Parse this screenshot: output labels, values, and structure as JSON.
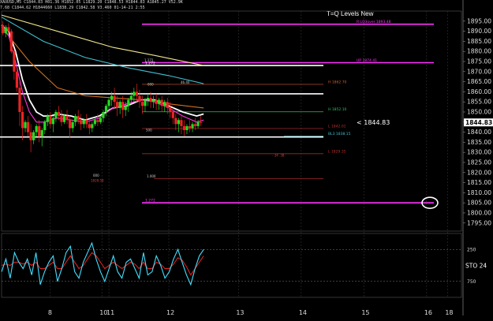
{
  "header": {
    "line1": "XAUUSD,M5  C1844.83  H01.36  H1852.05  L1829.20  C1848.53  H1844.83  A1845.27  V52.9K",
    "line2": "7.68  C1844.62  H1844660  L1838.29  C1842.58  V3.460  01-14-21  2:55"
  },
  "colors": {
    "background": "#000000",
    "candle_up": "#22dd22",
    "candle_down": "#ee2222",
    "level_line": "#ff33ff",
    "white_level": "#ffffff",
    "ma_white": "#ffffff",
    "ma_magenta": "#ff33dd",
    "ma_orange": "#d07020",
    "ma_yellow": "#f0e68c",
    "ma_cyan": "#40c0d0",
    "stoch_cyan": "#40e0ff",
    "stoch_red": "#e02020",
    "circle_marker": "#ffffff"
  },
  "chart_data": {
    "type": "line",
    "title": "T=Q Levels New",
    "current_price_label": "< 1844.83",
    "current_price_box": "1844.83",
    "ylim": [
      1791,
      1900
    ],
    "y_ticks": [
      1895.0,
      1890.0,
      1885.0,
      1880.0,
      1875.0,
      1870.0,
      1865.0,
      1860.0,
      1855.0,
      1850.0,
      1845.0,
      1840.0,
      1835.0,
      1830.0,
      1825.0,
      1820.0,
      1815.0,
      1810.0,
      1805.0,
      1800.0,
      1795.0
    ],
    "x_ticks": [
      "8",
      "10",
      "11",
      "12",
      "13",
      "14",
      "15",
      "16",
      "18"
    ],
    "x_tick_positions": [
      0.5,
      4.2,
      4.7,
      9,
      14,
      18.5,
      23,
      27.5,
      29
    ],
    "xlim": [
      -3,
      30
    ],
    "levels": [
      {
        "price": 1893.48,
        "color": "magenta",
        "label": "R:LQ3over 1893.48"
      },
      {
        "price": 1874.41,
        "color": "magenta",
        "label": "UP 1874.41"
      },
      {
        "price": 1873.0,
        "color": "white",
        "label": "1.272"
      },
      {
        "price": 1859.0,
        "color": "white",
        "label": ""
      },
      {
        "price": 1863.7,
        "color": "orange",
        "label": "H 1862.70"
      },
      {
        "price": 1850.1,
        "color": "green",
        "label": "H 1852.10"
      },
      {
        "price": 1841.81,
        "color": "red",
        "label": "L 1842.01"
      },
      {
        "price": 1837.6,
        "color": "white",
        "label": ""
      },
      {
        "price": 1838.15,
        "color": "cyan",
        "label": "BL3 1838.15"
      },
      {
        "price": 1829.35,
        "color": "red",
        "label": "L 1829.35"
      },
      {
        "price": 1817.0,
        "color": "red",
        "label": ""
      },
      {
        "price": 1805.0,
        "color": "magenta",
        "label": "1.272"
      }
    ],
    "annotations": [
      {
        "text": "1.272",
        "price": 1875.0
      },
      {
        "text": "000",
        "price": 1863.0
      },
      {
        "text": "46.40",
        "price": 1864.0
      },
      {
        "text": "500",
        "price": 1840.5
      },
      {
        "text": "1.000",
        "price": 1817.5
      },
      {
        "text": "000",
        "price": 1818.0
      },
      {
        "text": "1828.58",
        "price": 1815.5
      },
      {
        "text": "- 34 .38",
        "price": 1828.0
      }
    ],
    "candles": [
      {
        "x": -2.9,
        "o": 1893,
        "h": 1895,
        "c": 1889,
        "l": 1888
      },
      {
        "x": -2.7,
        "o": 1889,
        "h": 1893,
        "c": 1892,
        "l": 1887
      },
      {
        "x": -2.5,
        "o": 1892,
        "h": 1894,
        "c": 1890,
        "l": 1889
      },
      {
        "x": -2.3,
        "o": 1890,
        "h": 1891,
        "c": 1880,
        "l": 1879
      },
      {
        "x": -2.1,
        "o": 1880,
        "h": 1881,
        "c": 1870,
        "l": 1866
      },
      {
        "x": -1.9,
        "o": 1870,
        "h": 1872,
        "c": 1862,
        "l": 1860
      },
      {
        "x": -1.7,
        "o": 1862,
        "h": 1865,
        "c": 1850,
        "l": 1843
      },
      {
        "x": -1.5,
        "o": 1850,
        "h": 1853,
        "c": 1842,
        "l": 1836
      },
      {
        "x": -1.3,
        "o": 1842,
        "h": 1846,
        "c": 1845,
        "l": 1840
      },
      {
        "x": -1.1,
        "o": 1845,
        "h": 1848,
        "c": 1840,
        "l": 1838
      },
      {
        "x": -0.9,
        "o": 1840,
        "h": 1844,
        "c": 1836,
        "l": 1830
      },
      {
        "x": -0.7,
        "o": 1836,
        "h": 1841,
        "c": 1840,
        "l": 1834
      },
      {
        "x": -0.5,
        "o": 1840,
        "h": 1844,
        "c": 1843,
        "l": 1838
      },
      {
        "x": -0.3,
        "o": 1843,
        "h": 1846,
        "c": 1838,
        "l": 1835
      },
      {
        "x": -0.1,
        "o": 1838,
        "h": 1842,
        "c": 1841,
        "l": 1833
      },
      {
        "x": 0.1,
        "o": 1841,
        "h": 1846,
        "c": 1845,
        "l": 1839
      },
      {
        "x": 0.3,
        "o": 1845,
        "h": 1849,
        "c": 1848,
        "l": 1843
      },
      {
        "x": 0.5,
        "o": 1848,
        "h": 1850,
        "c": 1844,
        "l": 1842
      },
      {
        "x": 0.7,
        "o": 1844,
        "h": 1848,
        "c": 1847,
        "l": 1840
      },
      {
        "x": 0.9,
        "o": 1847,
        "h": 1851,
        "c": 1850,
        "l": 1845
      },
      {
        "x": 1.1,
        "o": 1850,
        "h": 1853,
        "c": 1848,
        "l": 1846
      },
      {
        "x": 1.3,
        "o": 1848,
        "h": 1851,
        "c": 1845,
        "l": 1843
      },
      {
        "x": 1.5,
        "o": 1845,
        "h": 1849,
        "c": 1848,
        "l": 1844
      },
      {
        "x": 1.7,
        "o": 1848,
        "h": 1851,
        "c": 1846,
        "l": 1844
      },
      {
        "x": 1.9,
        "o": 1846,
        "h": 1848,
        "c": 1842,
        "l": 1837
      },
      {
        "x": 2.1,
        "o": 1842,
        "h": 1846,
        "c": 1845,
        "l": 1840
      },
      {
        "x": 2.3,
        "o": 1845,
        "h": 1849,
        "c": 1848,
        "l": 1843
      },
      {
        "x": 2.5,
        "o": 1848,
        "h": 1851,
        "c": 1846,
        "l": 1844
      },
      {
        "x": 2.7,
        "o": 1846,
        "h": 1849,
        "c": 1844,
        "l": 1841
      },
      {
        "x": 2.9,
        "o": 1844,
        "h": 1847,
        "c": 1846,
        "l": 1842
      },
      {
        "x": 3.1,
        "o": 1846,
        "h": 1849,
        "c": 1844,
        "l": 1842
      },
      {
        "x": 3.3,
        "o": 1844,
        "h": 1846,
        "c": 1842,
        "l": 1839
      },
      {
        "x": 3.5,
        "o": 1842,
        "h": 1845,
        "c": 1844,
        "l": 1840
      },
      {
        "x": 3.7,
        "o": 1844,
        "h": 1847,
        "c": 1846,
        "l": 1843
      },
      {
        "x": 3.9,
        "o": 1846,
        "h": 1849,
        "c": 1845,
        "l": 1843
      },
      {
        "x": 4.1,
        "o": 1845,
        "h": 1848,
        "c": 1847,
        "l": 1844
      },
      {
        "x": 4.3,
        "o": 1847,
        "h": 1851,
        "c": 1850,
        "l": 1845
      },
      {
        "x": 4.5,
        "o": 1850,
        "h": 1854,
        "c": 1853,
        "l": 1848
      },
      {
        "x": 4.7,
        "o": 1853,
        "h": 1857,
        "c": 1856,
        "l": 1851
      },
      {
        "x": 4.9,
        "o": 1856,
        "h": 1860,
        "c": 1858,
        "l": 1853
      },
      {
        "x": 5.1,
        "o": 1858,
        "h": 1862,
        "c": 1855,
        "l": 1852
      },
      {
        "x": 5.3,
        "o": 1855,
        "h": 1858,
        "c": 1852,
        "l": 1848
      },
      {
        "x": 5.5,
        "o": 1852,
        "h": 1856,
        "c": 1855,
        "l": 1849
      },
      {
        "x": 5.7,
        "o": 1855,
        "h": 1858,
        "c": 1851,
        "l": 1847
      },
      {
        "x": 5.9,
        "o": 1851,
        "h": 1855,
        "c": 1853,
        "l": 1848
      },
      {
        "x": 6.1,
        "o": 1853,
        "h": 1857,
        "c": 1856,
        "l": 1850
      },
      {
        "x": 6.3,
        "o": 1856,
        "h": 1860,
        "c": 1858,
        "l": 1854
      },
      {
        "x": 6.5,
        "o": 1858,
        "h": 1862,
        "c": 1860,
        "l": 1855
      },
      {
        "x": 6.7,
        "o": 1860,
        "h": 1864,
        "c": 1858,
        "l": 1855
      },
      {
        "x": 6.9,
        "o": 1858,
        "h": 1861,
        "c": 1855,
        "l": 1852
      },
      {
        "x": 7.1,
        "o": 1855,
        "h": 1858,
        "c": 1853,
        "l": 1849
      },
      {
        "x": 7.3,
        "o": 1853,
        "h": 1857,
        "c": 1856,
        "l": 1850
      },
      {
        "x": 7.5,
        "o": 1856,
        "h": 1859,
        "c": 1857,
        "l": 1853
      },
      {
        "x": 7.7,
        "o": 1857,
        "h": 1860,
        "c": 1855,
        "l": 1852
      },
      {
        "x": 7.9,
        "o": 1855,
        "h": 1858,
        "c": 1856,
        "l": 1852
      },
      {
        "x": 8.1,
        "o": 1856,
        "h": 1859,
        "c": 1854,
        "l": 1851
      },
      {
        "x": 8.3,
        "o": 1854,
        "h": 1857,
        "c": 1856,
        "l": 1851
      },
      {
        "x": 8.5,
        "o": 1856,
        "h": 1858,
        "c": 1853,
        "l": 1850
      },
      {
        "x": 8.7,
        "o": 1853,
        "h": 1856,
        "c": 1855,
        "l": 1850
      },
      {
        "x": 8.9,
        "o": 1855,
        "h": 1857,
        "c": 1852,
        "l": 1849
      },
      {
        "x": 9.1,
        "o": 1852,
        "h": 1855,
        "c": 1850,
        "l": 1847
      },
      {
        "x": 9.3,
        "o": 1850,
        "h": 1852,
        "c": 1847,
        "l": 1844
      },
      {
        "x": 9.5,
        "o": 1847,
        "h": 1849,
        "c": 1844,
        "l": 1841
      },
      {
        "x": 9.7,
        "o": 1844,
        "h": 1847,
        "c": 1846,
        "l": 1840
      },
      {
        "x": 9.9,
        "o": 1846,
        "h": 1848,
        "c": 1843,
        "l": 1839
      },
      {
        "x": 10.1,
        "o": 1843,
        "h": 1846,
        "c": 1841,
        "l": 1838
      },
      {
        "x": 10.3,
        "o": 1841,
        "h": 1844,
        "c": 1843,
        "l": 1839
      },
      {
        "x": 10.5,
        "o": 1843,
        "h": 1846,
        "c": 1842,
        "l": 1840
      },
      {
        "x": 10.7,
        "o": 1842,
        "h": 1845,
        "c": 1844,
        "l": 1840
      },
      {
        "x": 10.9,
        "o": 1844,
        "h": 1847,
        "c": 1843,
        "l": 1841
      },
      {
        "x": 11.1,
        "o": 1843,
        "h": 1846,
        "c": 1845,
        "l": 1842
      },
      {
        "x": 11.3,
        "o": 1845,
        "h": 1848,
        "c": 1844.8,
        "l": 1843
      }
    ],
    "ma_series": [
      {
        "color": "yellow",
        "x": [
          -3,
          2,
          5,
          8,
          11.5
        ],
        "y": [
          1898,
          1888,
          1882,
          1878,
          1873
        ]
      },
      {
        "color": "cyan",
        "x": [
          -3,
          0,
          3,
          6,
          9,
          11.5
        ],
        "y": [
          1897,
          1885,
          1877,
          1872,
          1868,
          1864
        ]
      },
      {
        "color": "orange",
        "x": [
          -3,
          -1,
          1,
          3,
          5,
          7,
          9,
          11.5
        ],
        "y": [
          1892,
          1875,
          1862,
          1858,
          1857,
          1856,
          1854,
          1852
        ]
      },
      {
        "color": "white",
        "x": [
          -3,
          -2.5,
          -2,
          -1.5,
          -1,
          -0.5,
          0,
          0.5,
          1,
          2,
          3,
          4,
          5,
          6,
          7,
          8,
          9,
          10,
          11,
          11.5
        ],
        "y": [
          1893,
          1890,
          1880,
          1866,
          1856,
          1850,
          1848,
          1848,
          1849,
          1848,
          1846,
          1848,
          1852,
          1853,
          1856,
          1856,
          1853,
          1850,
          1848,
          1849
        ]
      },
      {
        "color": "magenta",
        "x": [
          -3,
          -2.5,
          -2,
          -1.5,
          -1,
          -0.5,
          0,
          0.5,
          1,
          2,
          3,
          4,
          5,
          6,
          7,
          8,
          9,
          10,
          11,
          11.5
        ],
        "y": [
          1893,
          1888,
          1875,
          1860,
          1850,
          1845,
          1845,
          1846,
          1847,
          1846,
          1845,
          1847,
          1852,
          1854,
          1856,
          1855,
          1852,
          1848,
          1845,
          1846
        ]
      }
    ],
    "oscillator": {
      "label": "STO 24",
      "levels": [
        "250",
        "750"
      ],
      "cyan": [
        40,
        60,
        30,
        70,
        55,
        45,
        60,
        35,
        70,
        20,
        40,
        55,
        65,
        25,
        45,
        70,
        80,
        40,
        30,
        55,
        70,
        85,
        60,
        40,
        25,
        45,
        65,
        40,
        30,
        55,
        60,
        45,
        30,
        70,
        35,
        40,
        65,
        50,
        30,
        40,
        60,
        75,
        55,
        35,
        20,
        45,
        65,
        75
      ],
      "red": [
        50,
        52,
        50,
        55,
        55,
        52,
        55,
        50,
        55,
        45,
        45,
        50,
        55,
        45,
        45,
        55,
        65,
        55,
        45,
        50,
        60,
        70,
        65,
        55,
        45,
        50,
        55,
        50,
        45,
        50,
        55,
        52,
        45,
        55,
        45,
        45,
        55,
        52,
        45,
        45,
        52,
        62,
        58,
        48,
        35,
        45,
        55,
        65
      ]
    }
  }
}
